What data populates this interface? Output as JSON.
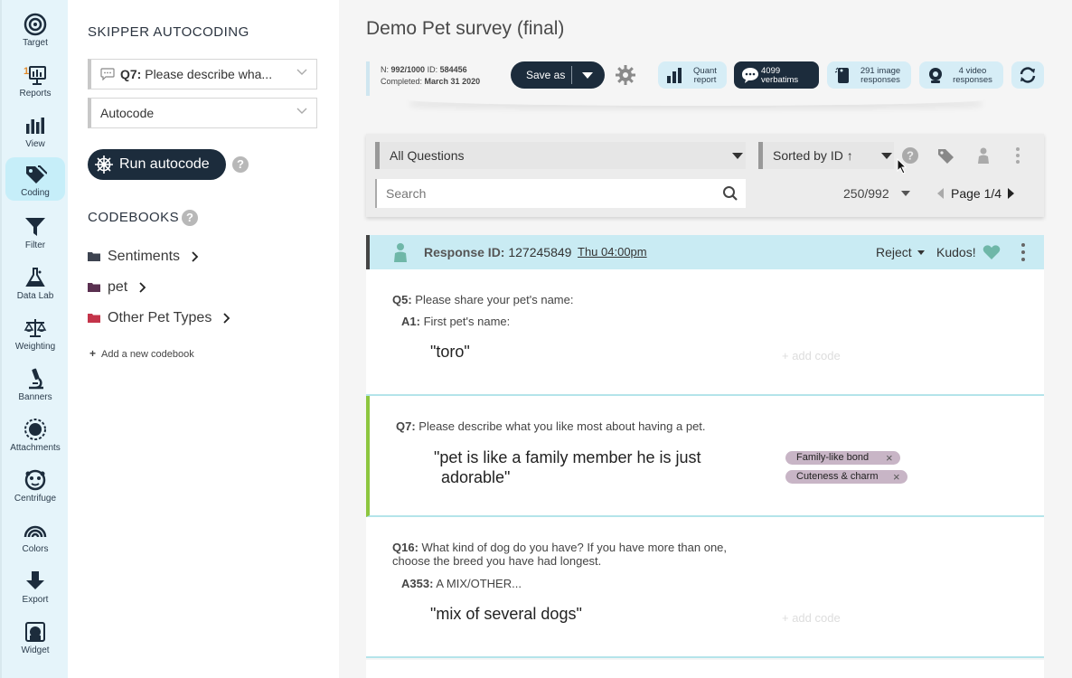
{
  "nav": {
    "items": [
      {
        "label": "Target",
        "icon": "target-icon"
      },
      {
        "label": "Reports",
        "icon": "reports-icon"
      },
      {
        "label": "View",
        "icon": "bar-chart-icon"
      },
      {
        "label": "Coding",
        "icon": "tags-icon",
        "active": true
      },
      {
        "label": "Filter",
        "icon": "funnel-icon"
      },
      {
        "label": "Data Lab",
        "icon": "flask-icon"
      },
      {
        "label": "Weighting",
        "icon": "scale-icon"
      },
      {
        "label": "Banners",
        "icon": "microscope-icon"
      },
      {
        "label": "Attachments",
        "icon": "sunburst-icon"
      },
      {
        "label": "Centrifuge",
        "icon": "centrifuge-icon"
      },
      {
        "label": "Colors",
        "icon": "rainbow-icon"
      },
      {
        "label": "Export",
        "icon": "download-arrow-icon"
      },
      {
        "label": "Widget",
        "icon": "widget-icon"
      }
    ],
    "reports_badge": "1"
  },
  "panel": {
    "title": "SKIPPER AUTOCODING",
    "question_select": {
      "prefix": "Q7:",
      "value": " Please describe wha..."
    },
    "mode_select": {
      "value": "Autocode"
    },
    "run_button": "Run autocode",
    "help": "?",
    "codebooks_title": "CODEBOOKS",
    "codebooks": [
      {
        "name": "Sentiments",
        "color": "#3d4350"
      },
      {
        "name": "pet",
        "color": "#5a3050"
      },
      {
        "name": "Other Pet Types",
        "color": "#c4344a"
      }
    ],
    "add_codebook": "Add a new codebook"
  },
  "main": {
    "survey_title": "Demo Pet survey (final)",
    "meta": {
      "n_label": "N:",
      "n_value": "992/1000",
      "id_label": "ID:",
      "id_value": "584456",
      "completed_label": "Completed:",
      "completed_value": "March 31 2020"
    },
    "save_as": "Save as",
    "pills": [
      {
        "l1": "Quant",
        "l2": "report"
      },
      {
        "l1": "4099",
        "l2": "verbatims"
      },
      {
        "l1": "291 image",
        "l2": "responses"
      },
      {
        "l1": "4 video",
        "l2": "responses"
      }
    ],
    "filter": {
      "question": "All Questions",
      "sort": "Sorted by ID ↑",
      "search_placeholder": "Search",
      "count": "250/992",
      "page": "Page 1/4"
    },
    "response": {
      "id_label": "Response ID:",
      "id_value": " 127245849",
      "time": "Thu 04:00pm",
      "reject": "Reject",
      "kudos": "Kudos!",
      "blocks": [
        {
          "q": "Q5:",
          "qtext": " Please share your pet's name:",
          "a": "A1:",
          "atext": " First pet's name:",
          "verbatim": "\"toro\"",
          "addcode": "+ add code"
        },
        {
          "q": "Q7:",
          "qtext": " Please describe what you like most about having a pet.",
          "verbatim1": "\"pet is like a family member he is just",
          "verbatim2": "adorable\"",
          "tags": [
            "Family-like bond",
            "Cuteness & charm"
          ],
          "tag_x": "×"
        },
        {
          "q": "Q16:",
          "qtext1": " What kind of dog do you have? If you have more than one,",
          "qtext2": "choose the breed you have had longest.",
          "a": "A353:",
          "atext": " A MIX/OTHER...",
          "verbatim": "\"mix of several dogs\"",
          "addcode": "+ add code"
        }
      ]
    }
  }
}
